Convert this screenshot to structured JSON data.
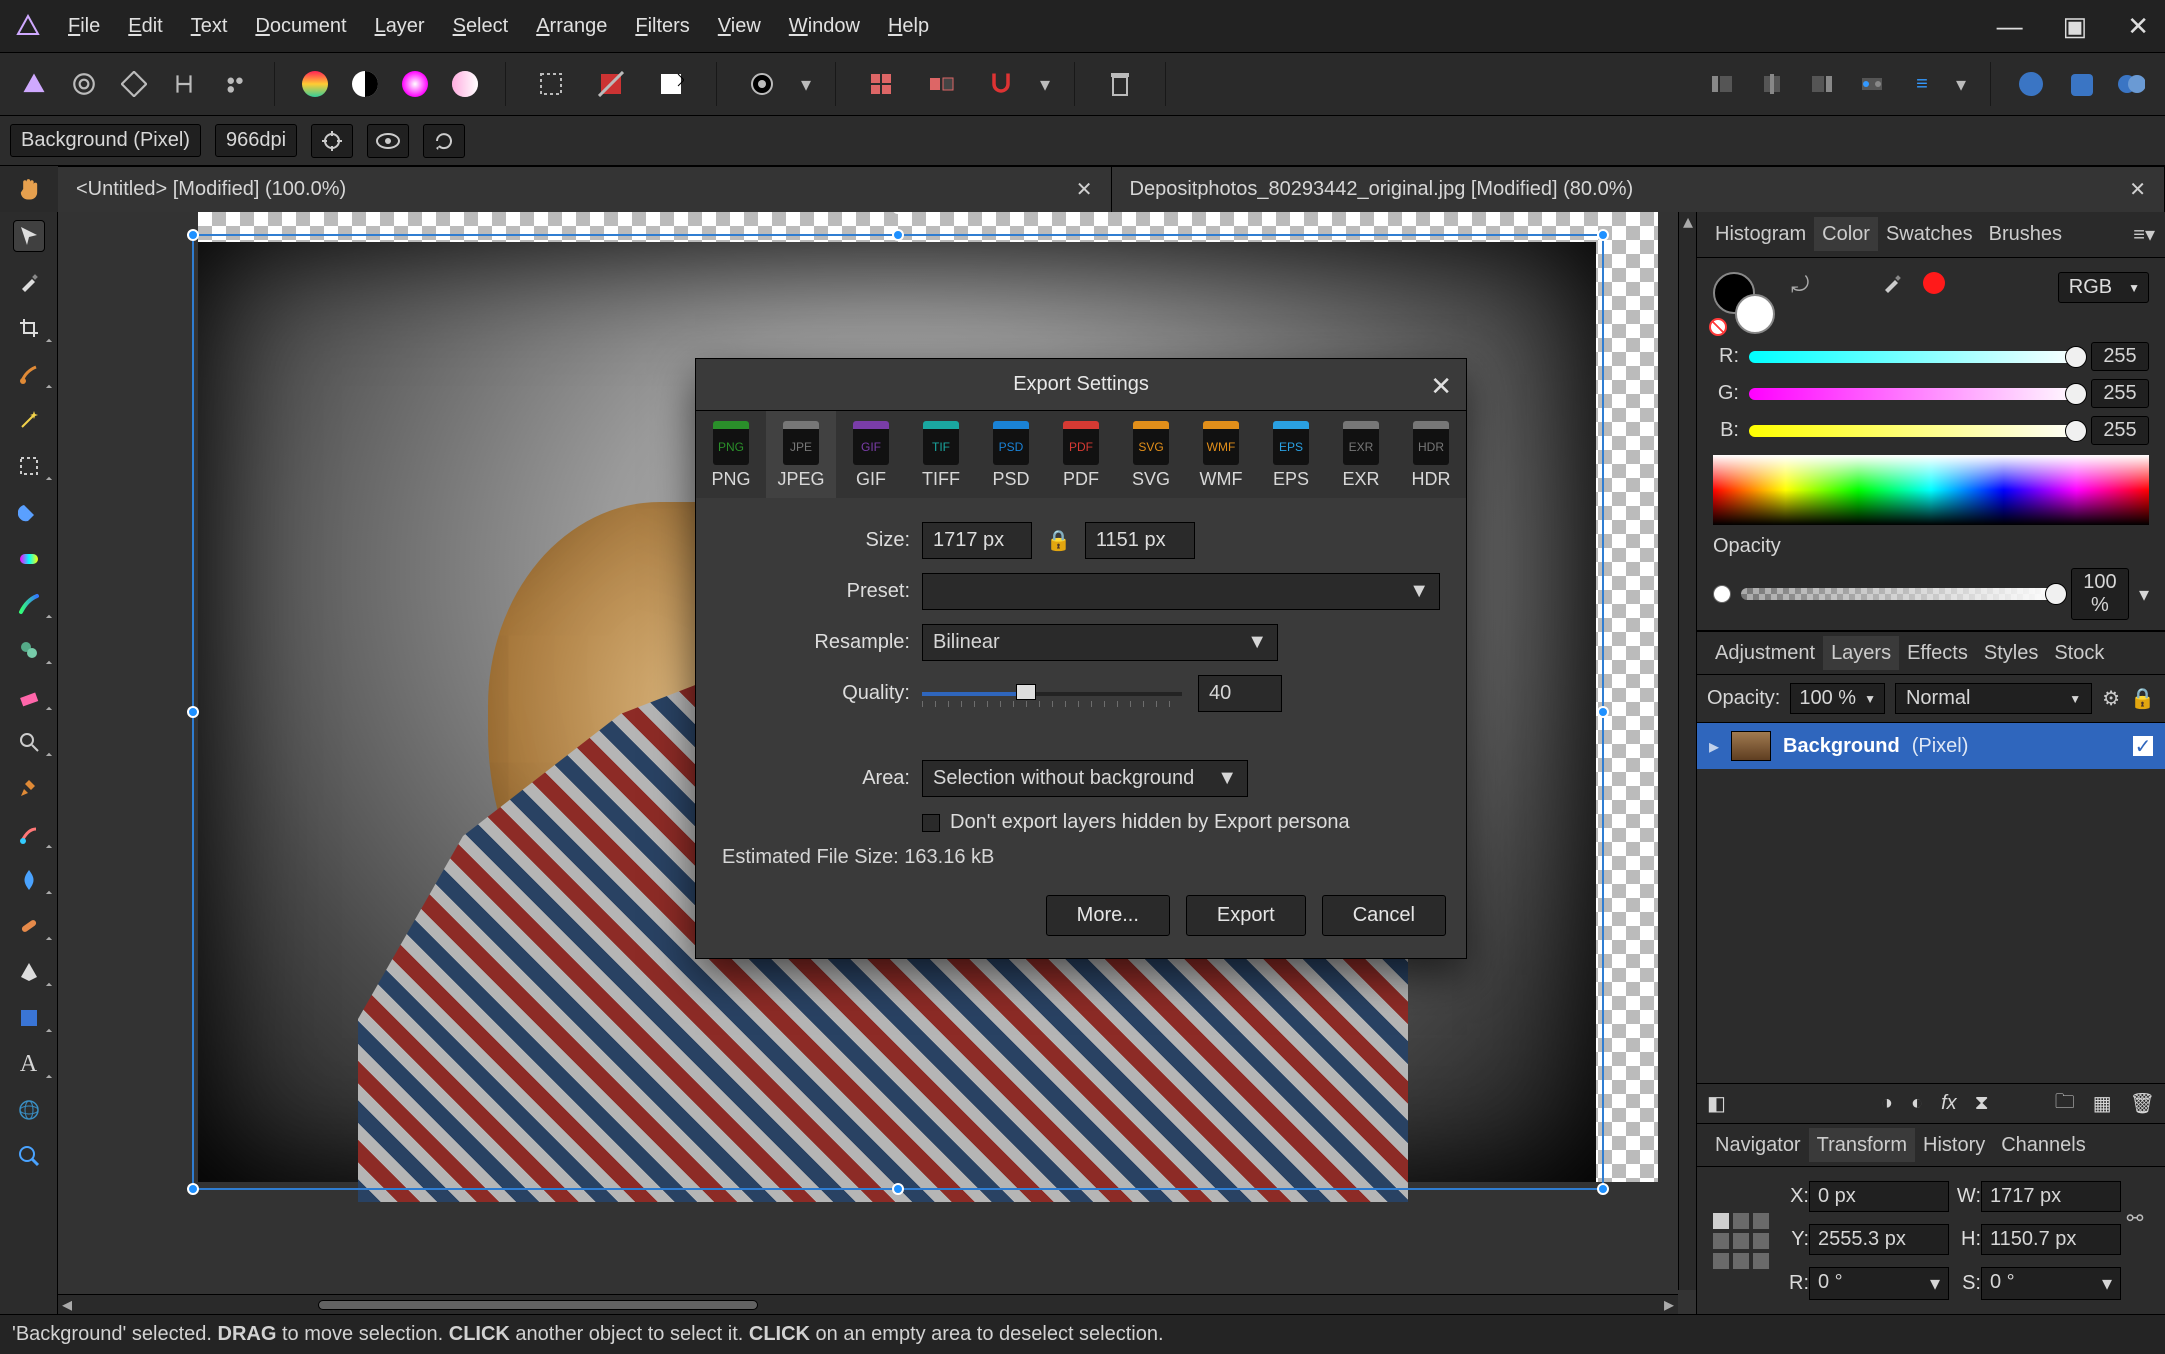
{
  "menubar": [
    "File",
    "Edit",
    "Text",
    "Document",
    "Layer",
    "Select",
    "Arrange",
    "Filters",
    "View",
    "Window",
    "Help"
  ],
  "contextbar": {
    "layer": "Background (Pixel)",
    "dpi": "966dpi"
  },
  "tabs": [
    {
      "label": "<Untitled> [Modified] (100.0%)"
    },
    {
      "label": "Depositphotos_80293442_original.jpg [Modified] (80.0%)"
    }
  ],
  "right": {
    "panel1_tabs": [
      "Histogram",
      "Color",
      "Swatches",
      "Brushes"
    ],
    "panel1_active": "Color",
    "color": {
      "mode": "RGB",
      "channels": [
        {
          "label": "R:",
          "value": "255",
          "gradient": "linear-gradient(to right,#00ffff,#ffffff)"
        },
        {
          "label": "G:",
          "value": "255",
          "gradient": "linear-gradient(to right,#ff00ff,#ffffff)"
        },
        {
          "label": "B:",
          "value": "255",
          "gradient": "linear-gradient(to right,#ffff00,#ffffff)"
        }
      ],
      "opacity_label": "Opacity",
      "opacity_value": "100 %"
    },
    "panel2_tabs": [
      "Adjustment",
      "Layers",
      "Effects",
      "Styles",
      "Stock"
    ],
    "panel2_active": "Layers",
    "layers": {
      "opacity_label": "Opacity:",
      "opacity_value": "100 %",
      "blend": "Normal",
      "items": [
        {
          "name": "Background",
          "type": "(Pixel)",
          "visible": true
        }
      ]
    },
    "panel3_tabs": [
      "Navigator",
      "Transform",
      "History",
      "Channels"
    ],
    "panel3_active": "Transform",
    "transform": {
      "x_label": "X:",
      "x_value": "0 px",
      "y_label": "Y:",
      "y_value": "2555.3 px",
      "w_label": "W:",
      "w_value": "1717 px",
      "h_label": "H:",
      "h_value": "1150.7 px",
      "r_label": "R:",
      "r_value": "0 °",
      "s_label": "S:",
      "s_value": "0 °"
    }
  },
  "dialog": {
    "title": "Export Settings",
    "formats": [
      "PNG",
      "JPEG",
      "GIF",
      "TIFF",
      "PSD",
      "PDF",
      "SVG",
      "WMF",
      "EPS",
      "EXR",
      "HDR"
    ],
    "format_active": "JPEG",
    "icon_colors": {
      "PNG": "#2a8f2a",
      "JPEG": "#777",
      "GIF": "#7a3da8",
      "TIFF": "#1aa7a0",
      "PSD": "#1a82d6",
      "PDF": "#d63a33",
      "SVG": "#e28f1a",
      "WMF": "#e28f1a",
      "EPS": "#2aa0e2",
      "EXR": "#777",
      "HDR": "#777"
    },
    "size_label": "Size:",
    "size_w": "1717 px",
    "size_h": "1151 px",
    "preset_label": "Preset:",
    "preset_value": "",
    "resample_label": "Resample:",
    "resample_value": "Bilinear",
    "quality_label": "Quality:",
    "quality_value": "40",
    "area_label": "Area:",
    "area_value": "Selection without background",
    "dontexport_label": "Don't export layers hidden by Export persona",
    "est_label": "Estimated File Size:",
    "est_value": "163.16 kB",
    "buttons": {
      "more": "More...",
      "export": "Export",
      "cancel": "Cancel"
    }
  },
  "statusbar": {
    "text1": "'Background' selected. ",
    "b1": "DRAG",
    "text2": " to move selection. ",
    "b2": "CLICK",
    "text3": " another object to select it. ",
    "b3": "CLICK",
    "text4": " on an empty area to deselect selection."
  }
}
